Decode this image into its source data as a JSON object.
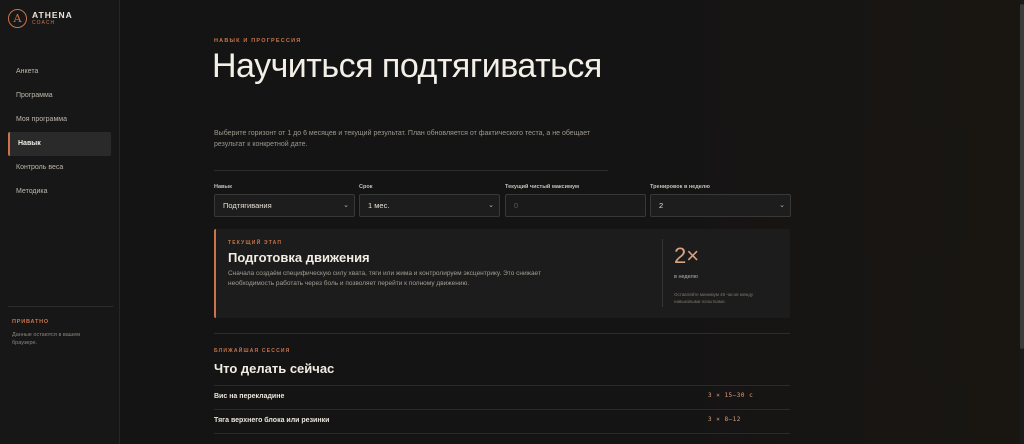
{
  "brand": {
    "mark": "A",
    "name": "ATHENA",
    "sub": "COACH"
  },
  "nav": {
    "items": [
      {
        "label": "Анкета",
        "active": false
      },
      {
        "label": "Программа",
        "active": false
      },
      {
        "label": "Моя программа",
        "active": false
      },
      {
        "label": "Навык",
        "active": true
      },
      {
        "label": "Контроль веса",
        "active": false
      },
      {
        "label": "Методика",
        "active": false
      }
    ]
  },
  "privacy": {
    "title": "ПРИВАТНО",
    "text": "Данные остаются в вашем браузере."
  },
  "header": {
    "kicker": "НАВЫК И ПРОГРЕССИЯ",
    "title": "Научиться подтягиваться",
    "description": "Выберите горизонт от 1 до 6 месяцев и текущий результат. План обновляется от фактического теста, а не обещает результат к конкретной дате."
  },
  "form": {
    "skill": {
      "label": "Навык",
      "value": "Подтягивания"
    },
    "term": {
      "label": "Срок",
      "value": "1 мес."
    },
    "max": {
      "label": "Текущий чистый максимум",
      "placeholder": "0"
    },
    "per_week": {
      "label": "Тренировок в неделю",
      "value": "2"
    }
  },
  "stage": {
    "kicker": "ТЕКУЩИЙ ЭТАП",
    "title": "Подготовка движения",
    "description": "Сначала создаём специфическую силу хвата, тяги или жима и контролируем эксцентрику. Это снижает необходимость работать через боль и позволяет перейти к полному движению.",
    "frequency": "2×",
    "frequency_label": "в неделю",
    "frequency_note": "Оставляйте минимум 48 часов между навыковыми попытками."
  },
  "session": {
    "kicker": "БЛИЖАЙШАЯ СЕССИЯ",
    "title": "Что делать сейчас",
    "exercises": [
      {
        "name": "Вис на перекладине",
        "sets": "3 × 15–30 с"
      },
      {
        "name": "Тяга верхнего блока или резинки",
        "sets": "3 × 8–12"
      }
    ]
  },
  "colors": {
    "accent": "#c9744a",
    "background": "#141414",
    "sidebar": "#171717"
  }
}
